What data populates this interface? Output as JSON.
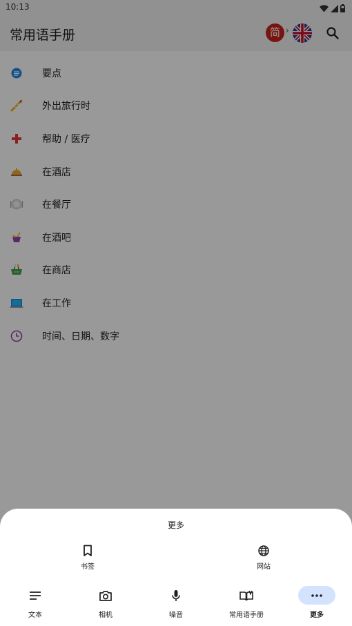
{
  "status_bar": {
    "time": "10:13",
    "icons": [
      "wifi-icon",
      "signal-icon",
      "battery-icon"
    ]
  },
  "app_bar": {
    "title": "常用语手册",
    "source_lang_badge": "简",
    "lang_separator": "›",
    "target_lang_flag": "uk-flag-icon",
    "search_icon": "search-icon"
  },
  "categories": [
    {
      "label": "要点",
      "icon": "essentials-icon",
      "color": "#1e88e5"
    },
    {
      "label": "外出旅行时",
      "icon": "airplane-icon",
      "color": "#f4b400"
    },
    {
      "label": "帮助 / 医疗",
      "icon": "medical-cross-icon",
      "color": "#e53935"
    },
    {
      "label": "在酒店",
      "icon": "hotel-bell-icon",
      "color": "#f9a825"
    },
    {
      "label": "在餐厅",
      "icon": "dining-plate-icon",
      "color": "#bdbdbd"
    },
    {
      "label": "在酒吧",
      "icon": "cocktail-icon",
      "color": "#8e44ad"
    },
    {
      "label": "在商店",
      "icon": "shopping-basket-icon",
      "color": "#43a047"
    },
    {
      "label": "在工作",
      "icon": "laptop-icon",
      "color": "#1e88e5"
    },
    {
      "label": "时间、日期、数字",
      "icon": "clock-icon",
      "color": "#8e44ad"
    }
  ],
  "more_sheet": {
    "title": "更多",
    "options": [
      {
        "label": "书签",
        "icon": "bookmark-icon"
      },
      {
        "label": "网站",
        "icon": "globe-icon"
      }
    ]
  },
  "bottom_nav": {
    "items": [
      {
        "label": "文本",
        "icon": "text-lines-icon",
        "active": false
      },
      {
        "label": "相机",
        "icon": "camera-icon",
        "active": false
      },
      {
        "label": "噪音",
        "icon": "microphone-icon",
        "active": false
      },
      {
        "label": "常用语手册",
        "icon": "phrasebook-icon",
        "active": false
      },
      {
        "label": "更多",
        "icon": "more-dots-icon",
        "active": true
      }
    ]
  },
  "colors": {
    "app_bar_bg": "#f2f2f2",
    "lang_badge_bg": "#c8221b",
    "active_nav_bg": "#d3e3fd",
    "scrim": "rgba(0,0,0,0.40)"
  }
}
